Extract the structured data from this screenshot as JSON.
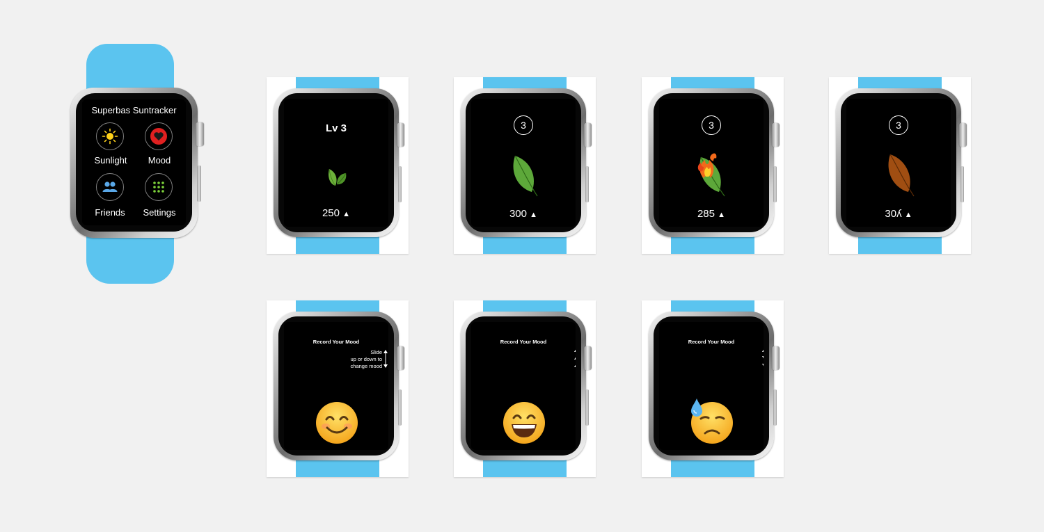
{
  "main_watch": {
    "title": "Superbas Suntracker",
    "menu": [
      {
        "label": "Sunlight",
        "icon": "sun-icon"
      },
      {
        "label": "Mood",
        "icon": "heart-icon"
      },
      {
        "label": "Friends",
        "icon": "friends-icon"
      },
      {
        "label": "Settings",
        "icon": "grid-icon"
      }
    ]
  },
  "row1": [
    {
      "header": "Lv 3",
      "score": "250",
      "icon": "sprout-icon"
    },
    {
      "header": "3",
      "score": "300",
      "icon": "green-leaf-icon"
    },
    {
      "header": "3",
      "score": "285",
      "icon": "burning-leaf-icon"
    },
    {
      "header": "3",
      "score": "30",
      "score_glyph": "ʎ",
      "icon": "brown-leaf-icon"
    }
  ],
  "row2": [
    {
      "title": "Record Your Mood",
      "hint": [
        "Slide",
        "up or down to",
        "change mood"
      ],
      "icon": "smiling-face-icon"
    },
    {
      "title": "Record Your Mood",
      "icon": "grinning-face-icon"
    },
    {
      "title": "Record Your Mood",
      "icon": "sweat-face-icon"
    }
  ],
  "colors": {
    "band": "#5bc4ef",
    "background": "#f1f1f1",
    "mood_heart": "#e02020",
    "grid_dots": "#7dd23a",
    "sun": "#ffd21a",
    "friends": "#5aa8e8"
  }
}
